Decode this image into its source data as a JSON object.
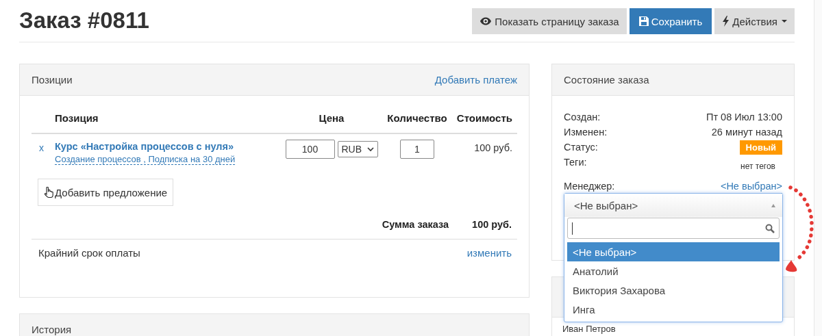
{
  "page": {
    "title": "Заказ #0811"
  },
  "toolbar": [
    {
      "kind": "view",
      "label": "Показать страницу заказа"
    },
    {
      "kind": "save",
      "label": "Сохранить"
    },
    {
      "kind": "actions",
      "label": "Действия"
    }
  ],
  "items_panel": {
    "title": "Позиции",
    "header_link": "Добавить платеж",
    "columns": [
      "Позиция",
      "Цена",
      "Количество",
      "Стоимость"
    ],
    "rows": [
      {
        "remove": "x",
        "name": "Курс «Настройка процессов с нуля»",
        "offers": "Создание процессов , Подписка на 30 дней",
        "price": "100",
        "currency": "RUB",
        "quantity": "1",
        "cost": "100 руб."
      }
    ],
    "add_button": "Добавить предложение",
    "total_label": "Сумма заказа",
    "total": "100 руб.",
    "deadline_label": "Крайний срок оплаты",
    "deadline_link": "изменить"
  },
  "history_panel": {
    "title": "История"
  },
  "state_panel": {
    "title": "Состояние заказа",
    "fields": [
      {
        "kind": "text",
        "label": "Создан:",
        "value": "Пт 08 Июл 13:00"
      },
      {
        "kind": "text",
        "label": "Изменен:",
        "value": "26 минут назад"
      },
      {
        "kind": "badge",
        "label": "Статус:",
        "value": "Новый"
      },
      {
        "kind": "note",
        "label": "Теги:",
        "value": "нет тегов"
      }
    ],
    "manager": {
      "label": "Менеджер:",
      "value": "<Не выбран>"
    }
  },
  "manager_dropdown": {
    "value": "<Не выбран>",
    "options": [
      {
        "label": "<Не выбран>",
        "selected": true
      },
      {
        "label": "Анатолий",
        "selected": false
      },
      {
        "label": "Виктория Захарова",
        "selected": false
      },
      {
        "label": "Инга",
        "selected": false
      }
    ]
  },
  "second_panel": {
    "rows": [
      "Иван Петров"
    ]
  }
}
